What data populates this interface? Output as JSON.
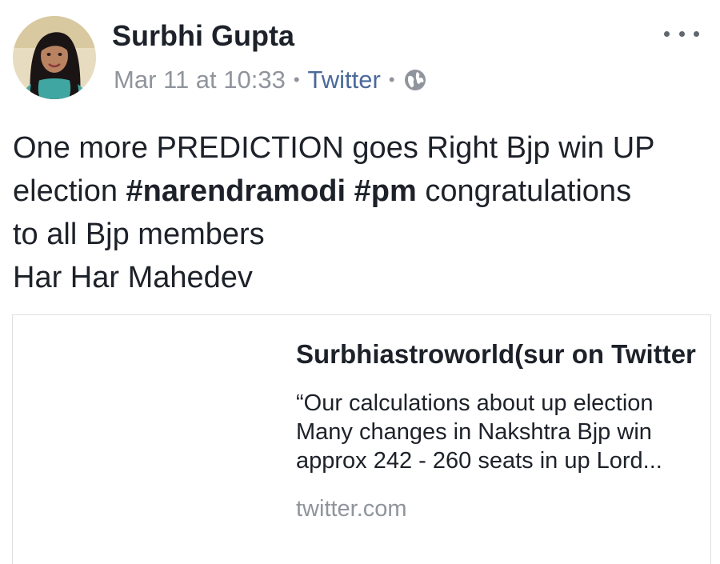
{
  "post": {
    "author": "Surbhi Gupta",
    "date": "Mar 11 at 10:33",
    "separator": "•",
    "source": "Twitter",
    "privacy_icon": "globe-icon",
    "more_icon": "more-options-icon",
    "text": {
      "line1": "One more PREDICTION goes Right Bjp win UP",
      "line2_start": "election ",
      "hashtag1": "#narendramodi",
      "space": " ",
      "hashtag2": "#pm",
      "line2_end": " congratulations",
      "line3": "to all Bjp members",
      "line4": "Har Har Mahedev"
    }
  },
  "link_card": {
    "title": "Surbhiastroworld(sur on Twitter",
    "description": "“Our calculations about up election Many changes in Nakshtra Bjp win approx 242 - 260 seats in up Lord...",
    "domain": "twitter.com"
  },
  "colors": {
    "text": "#1d2129",
    "meta": "#90949c",
    "link": "#4b6a9b",
    "border": "#dddfe2"
  }
}
